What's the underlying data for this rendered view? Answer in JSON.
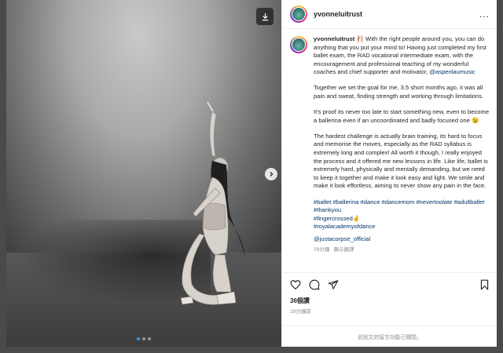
{
  "post": {
    "username": "yvonneluitrust",
    "more_label": "...",
    "caption_paragraphs": [
      "With the right people around you, you can do anything that you put your mind to! Having just completed my first ballet exam, the RAD vocational intermediate exam, with the encouragement and professional teaching of my wonderful coaches and chief supporter and motivator,",
      "Together we set the goal for me, 3.5 short months ago, it was all pain and sweat, finding strength and working through limitations.",
      "It's proof its never too late to start something new, even to become a ballerina even if an uncoordinated and badly focused one 😉",
      "The hardest challenge is actually brain training, its hard to focus and memorise the moves, especially as the RAD syllabus is extremely long and complex! All worth it though, I really enjoyed the process and it offered me new lessons in life. Like life, ballet is extremely hard, physically and mentally demanding, but we need to keep it together and make it look easy and light. We smile and make it look effortless, aiming to never show any pain in the face."
    ],
    "caption_badge": "🩰",
    "mention_1": "@aspenlaumusic",
    "hashtags_line1": "#ballet #ballerina #dance #dancemom #nevertoolate #adultballet #thankyou",
    "hashtags_line2": "#fingercrossed🤞",
    "hashtags_line3": "#royalacademyofdance",
    "mention_2": "@justacorpse_official",
    "caption_time": "29分鐘",
    "translate_label": "顯示翻譯",
    "likes": "36個讚",
    "posted_ago": "29分鐘前",
    "comments_disabled": "此貼文的留言功能已關閉。"
  },
  "icons": {
    "download": "download-icon",
    "next": "chevron-right-icon",
    "heart": "heart-icon",
    "comment": "comment-icon",
    "share": "share-icon",
    "save": "bookmark-icon"
  },
  "carousel": {
    "total": 3,
    "active": 0
  },
  "colors": {
    "accent": "#3897f0",
    "link": "#00376b",
    "text": "#262626",
    "muted": "#8e8e8e"
  }
}
